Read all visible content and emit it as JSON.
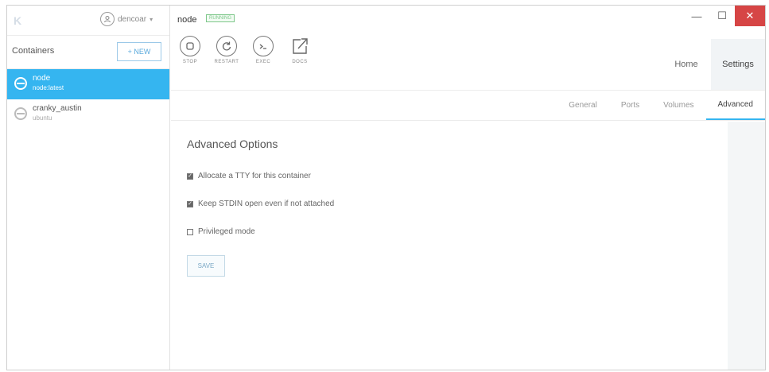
{
  "sidebar": {
    "logo": "K",
    "username": "dencoar",
    "containers_title": "Containers",
    "new_button": "+ NEW",
    "items": [
      {
        "name": "node",
        "image": "node:latest",
        "active": true
      },
      {
        "name": "cranky_austin",
        "image": "ubuntu",
        "active": false
      }
    ]
  },
  "header": {
    "container_name": "node",
    "status": "RUNNING",
    "actions": [
      {
        "label": "STOP",
        "icon": "stop-icon"
      },
      {
        "label": "RESTART",
        "icon": "restart-icon"
      },
      {
        "label": "EXEC",
        "icon": "terminal-icon"
      },
      {
        "label": "DOCS",
        "icon": "external-link-icon"
      }
    ],
    "nav_tabs": [
      {
        "label": "Home",
        "selected": false
      },
      {
        "label": "Settings",
        "selected": true
      }
    ],
    "window_controls": {
      "minimize": "—",
      "maximize": "☐",
      "close": "✕"
    }
  },
  "subtabs": [
    {
      "label": "General",
      "selected": false
    },
    {
      "label": "Ports",
      "selected": false
    },
    {
      "label": "Volumes",
      "selected": false
    },
    {
      "label": "Advanced",
      "selected": true
    }
  ],
  "advanced": {
    "title": "Advanced Options",
    "options": [
      {
        "label": "Allocate a TTY for this container",
        "checked": true
      },
      {
        "label": "Keep STDIN open even if not attached",
        "checked": true
      },
      {
        "label": "Privileged mode",
        "checked": false
      }
    ],
    "save_label": "SAVE"
  },
  "colors": {
    "accent": "#35b5f0",
    "status": "#7dc78a",
    "close": "#d64545"
  }
}
